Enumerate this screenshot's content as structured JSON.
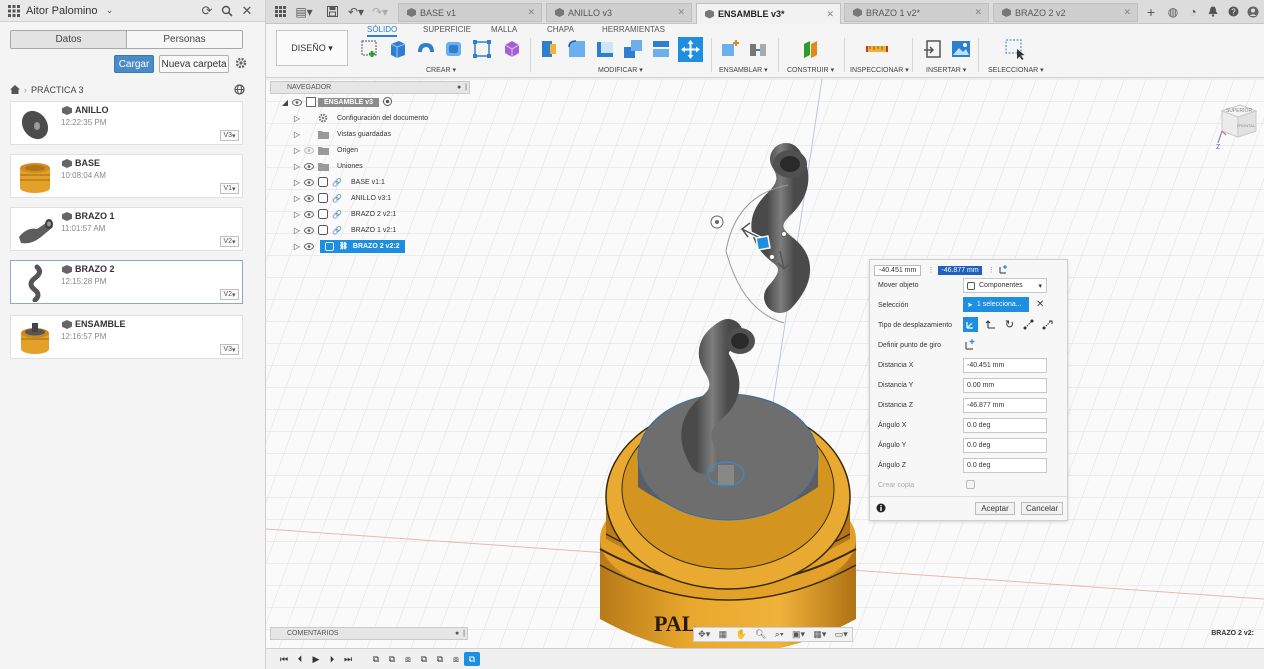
{
  "user": {
    "name": "Aitor Palomino"
  },
  "data_panel": {
    "tabs": [
      "Datos",
      "Personas"
    ],
    "load_button": "Cargar",
    "new_folder_button": "Nueva carpeta",
    "breadcrumb": "PRÁCTICA 3",
    "files": [
      {
        "name": "ANILLO",
        "time": "12:22:35 PM",
        "version": "V3"
      },
      {
        "name": "BASE",
        "time": "10:08:04 AM",
        "version": "V1"
      },
      {
        "name": "BRAZO 1",
        "time": "11:01:57 AM",
        "version": "V2"
      },
      {
        "name": "BRAZO 2",
        "time": "12:15:28 PM",
        "version": "V2"
      },
      {
        "name": "ENSAMBLE",
        "time": "12:16:57 PM",
        "version": "V3"
      }
    ]
  },
  "doc_tabs": [
    {
      "label": "BASE v1"
    },
    {
      "label": "ANILLO v3"
    },
    {
      "label": "ENSAMBLE v3*"
    },
    {
      "label": "BRAZO 1 v2*"
    },
    {
      "label": "BRAZO 2 v2"
    }
  ],
  "ribbon": {
    "workspace": "DISEÑO",
    "tabs": [
      "SÓLIDO",
      "SUPERFICIE",
      "MALLA",
      "CHAPA",
      "HERRAMIENTAS"
    ],
    "groups": [
      "CREAR",
      "MODIFICAR",
      "ENSAMBLAR",
      "CONSTRUIR",
      "INSPECCIONAR",
      "INSERTAR",
      "SELECCIONAR"
    ]
  },
  "browser": {
    "title": "NAVEGADOR",
    "root": "ENSAMBLE v3",
    "items": [
      "Configuración del documento",
      "Vistas guardadas",
      "Origen",
      "Uniones",
      "BASE v1:1",
      "ANILLO v3:1",
      "BRAZO 2 v2:1",
      "BRAZO 1 v2:1",
      "BRAZO 2 v2:2"
    ]
  },
  "move_dialog": {
    "header_x": "-40.451 mm",
    "header_z": "-46.877 mm",
    "rows": {
      "move_object": "Mover objeto",
      "move_object_value": "Componentes",
      "selection": "Selección",
      "selection_value": "1 selecciona...",
      "move_type": "Tipo de desplazamiento",
      "pivot": "Definir punto de giro",
      "dist_x": "Distancia X",
      "dist_y": "Distancia Y",
      "dist_z": "Distancia Z",
      "ang_x": "Ángulo X",
      "ang_y": "Ángulo Y",
      "ang_z": "Ángulo Z",
      "copy": "Crear copia"
    },
    "values": {
      "dist_x": "-40.451 mm",
      "dist_y": "0.00 mm",
      "dist_z": "-46.877 mm",
      "ang_x": "0.0 deg",
      "ang_y": "0.0 deg",
      "ang_z": "0.0 deg"
    },
    "ok": "Aceptar",
    "cancel": "Cancelar"
  },
  "comments": "COMENTARIOS",
  "status": "BRAZO 2 v2:",
  "viewcube": {
    "top": "SUPERIOR",
    "front": "FRONTAL"
  },
  "scene_text": "PAL",
  "colors": {
    "accent": "#1e8fe0",
    "base_gold": "#e3a12a",
    "part_gray": "#6a6a6a"
  }
}
